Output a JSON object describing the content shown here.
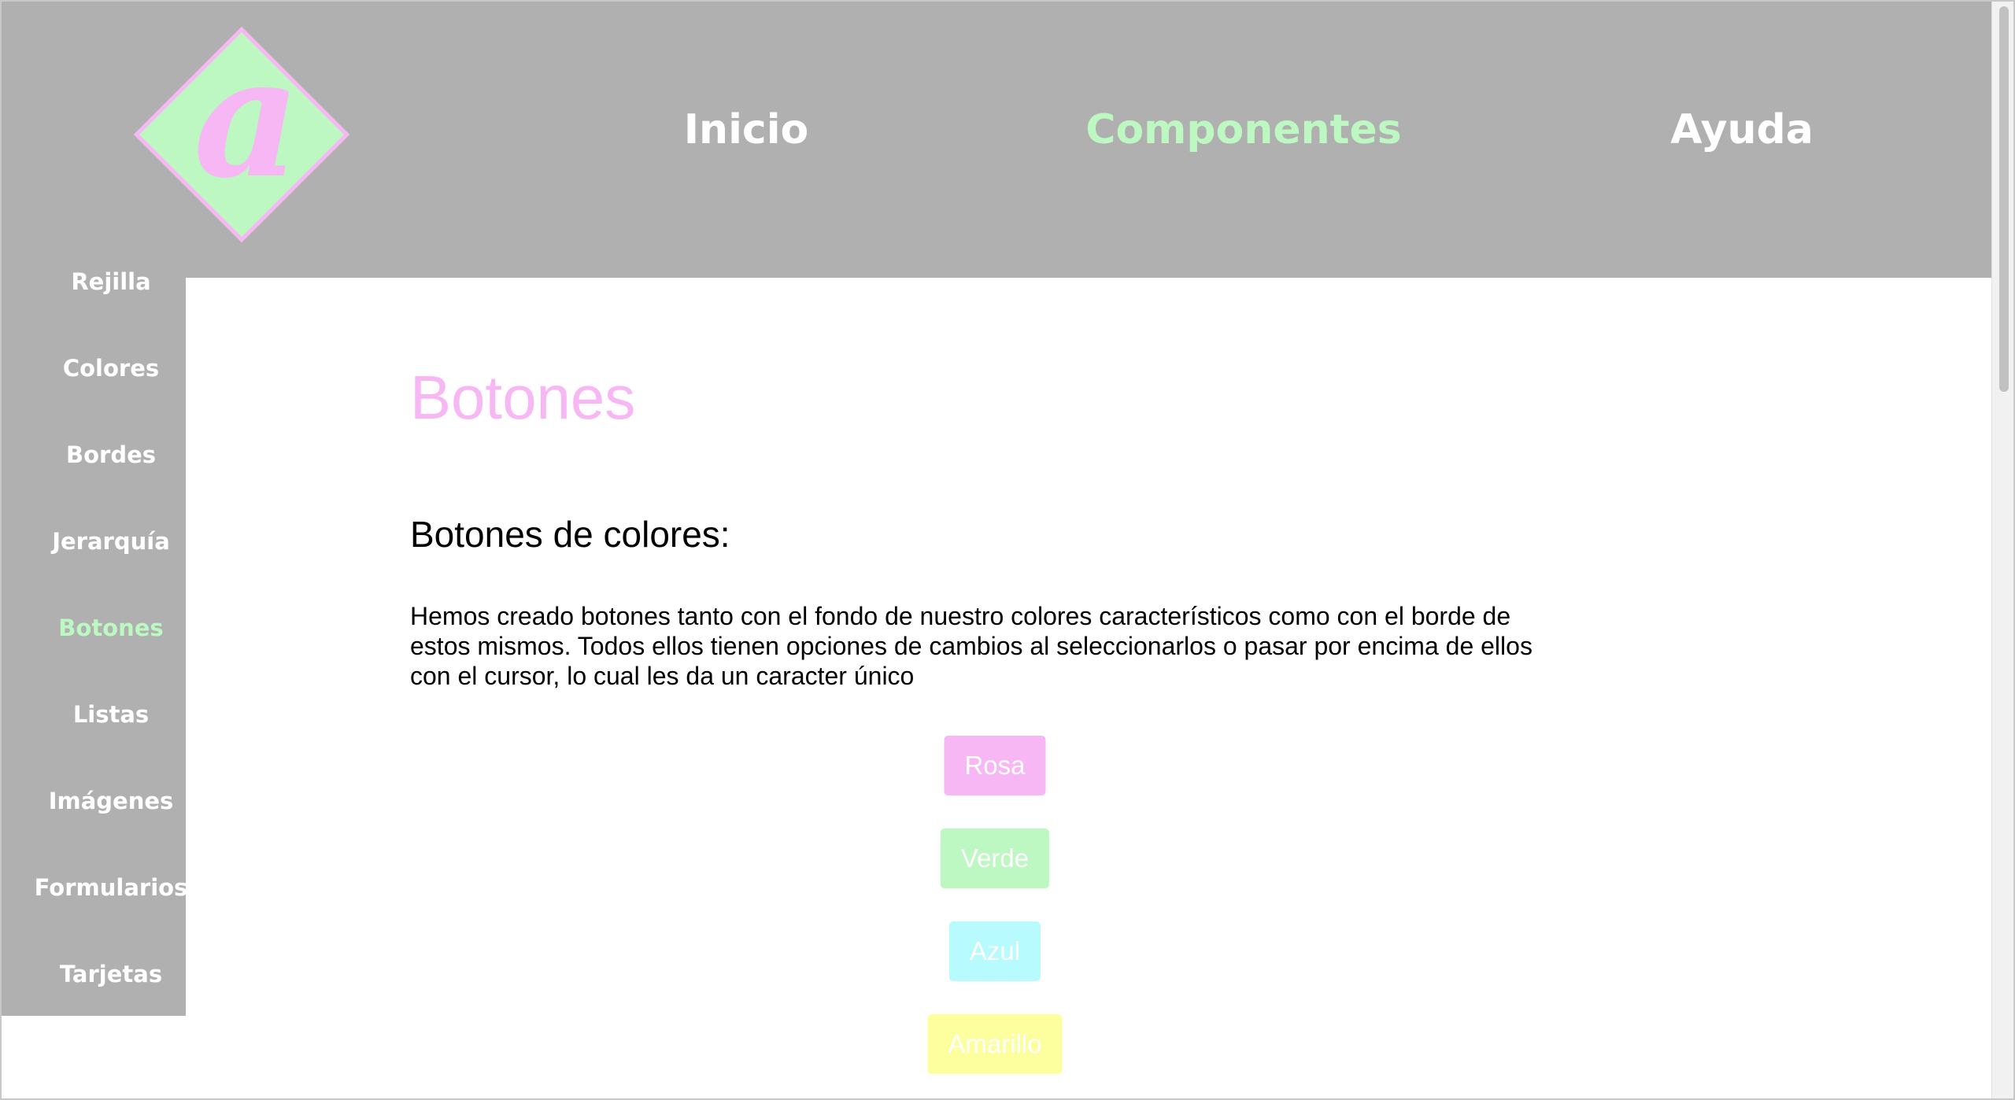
{
  "logo": {
    "letter": "a"
  },
  "top_nav": [
    {
      "label": "Inicio",
      "active": false
    },
    {
      "label": "Componentes",
      "active": true
    },
    {
      "label": "Ayuda",
      "active": false
    }
  ],
  "side_nav": [
    {
      "label": "Rejilla",
      "active": false
    },
    {
      "label": "Colores",
      "active": false
    },
    {
      "label": "Bordes",
      "active": false
    },
    {
      "label": "Jerarquía",
      "active": false
    },
    {
      "label": "Botones",
      "active": true
    },
    {
      "label": "Listas",
      "active": false
    },
    {
      "label": "Imágenes",
      "active": false
    },
    {
      "label": "Formularios",
      "active": false
    },
    {
      "label": "Tarjetas",
      "active": false
    }
  ],
  "main": {
    "title": "Botones",
    "subtitle": "Botones de colores:",
    "paragraph": "Hemos creado botones tanto con el fondo de nuestro colores característicos como con el borde de estos mismos. Todos ellos tienen opciones de cambios al seleccionarlos o pasar por encima de ellos con el cursor, lo cual les da un caracter único",
    "buttons": [
      {
        "label": "Rosa",
        "color": "#f7b7f4"
      },
      {
        "label": "Verde",
        "color": "#bdf7c1"
      },
      {
        "label": "Azul",
        "color": "#b7fbff"
      },
      {
        "label": "Amarillo",
        "color": "#fdff9e"
      }
    ]
  },
  "colors": {
    "header_bg": "#b0b0b0",
    "accent_pink": "#f7b7f4",
    "accent_green": "#bdf7c1"
  }
}
